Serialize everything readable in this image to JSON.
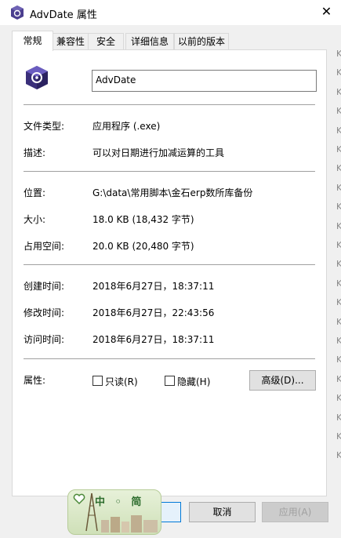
{
  "window": {
    "title": "AdvDate 属性",
    "close_glyph": "✕"
  },
  "tabs": [
    {
      "label": "常规",
      "active": true
    },
    {
      "label": "兼容性"
    },
    {
      "label": "安全"
    },
    {
      "label": "详细信息"
    },
    {
      "label": "以前的版本"
    }
  ],
  "general": {
    "file_name": "AdvDate",
    "file_type_label": "文件类型:",
    "file_type_value": "应用程序 (.exe)",
    "description_label": "描述:",
    "description_value": "可以对日期进行加减运算的工具",
    "location_label": "位置:",
    "location_value": "G:\\data\\常用脚本\\金石erp数所库备份",
    "size_label": "大小:",
    "size_value": "18.0 KB (18,432 字节)",
    "disk_size_label": "占用空间:",
    "disk_size_value": "20.0 KB (20,480 字节)",
    "created_label": "创建时间:",
    "created_value": "2018年6月27日，18:37:11",
    "modified_label": "修改时间:",
    "modified_value": "2018年6月27日，22:43:56",
    "accessed_label": "访问时间:",
    "accessed_value": "2018年6月27日，18:37:11",
    "attributes_label": "属性:",
    "readonly_label": "只读(R)",
    "hidden_label": "隐藏(H)",
    "advanced_button": "高级(D)..."
  },
  "buttons": {
    "ok": "",
    "cancel": "取消",
    "apply": "应用(A)"
  },
  "side_strip_letters": [
    "K",
    "K",
    "K",
    "K",
    "K",
    "K",
    "K",
    "K",
    "K",
    "K",
    "K",
    "K",
    "K",
    "K",
    "K",
    "K",
    "K",
    "K",
    "K",
    "K",
    "K",
    "K"
  ],
  "watermark": {
    "text": "中 ◦ 简"
  },
  "colors": {
    "panel_bg": "#ffffff",
    "window_bg": "#f0f0f0",
    "focus_blue": "#0078d7"
  }
}
